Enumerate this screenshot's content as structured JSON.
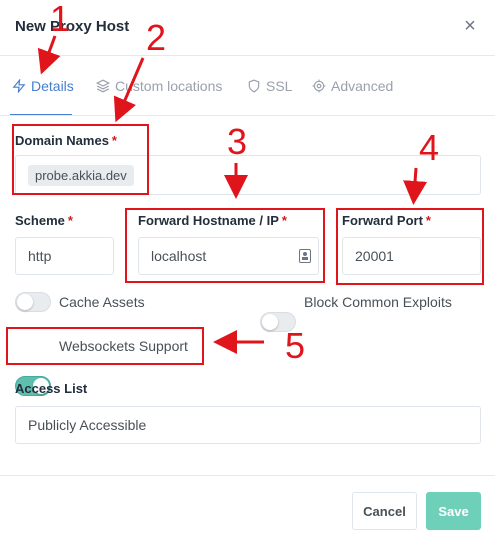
{
  "modal": {
    "title": "New Proxy Host",
    "close_symbol": "×"
  },
  "tabs": [
    {
      "label": "Details",
      "icon": "bolt-icon",
      "active": true
    },
    {
      "label": "Custom locations",
      "icon": "layers-icon",
      "active": false
    },
    {
      "label": "SSL",
      "icon": "shield-icon",
      "active": false
    },
    {
      "label": "Advanced",
      "icon": "gear-icon",
      "active": false
    }
  ],
  "form": {
    "domain_names": {
      "label": "Domain Names",
      "required_mark": "*",
      "tags": [
        "probe.akkia.dev"
      ]
    },
    "scheme": {
      "label": "Scheme",
      "required_mark": "*",
      "value": "http"
    },
    "forward_host": {
      "label": "Forward Hostname / IP",
      "required_mark": "*",
      "value": "localhost"
    },
    "forward_port": {
      "label": "Forward Port",
      "required_mark": "*",
      "value": "20001"
    },
    "toggles": [
      {
        "label": "Cache Assets",
        "checked": false
      },
      {
        "label": "Block Common Exploits",
        "checked": false
      },
      {
        "label": "Websockets Support",
        "checked": true
      }
    ],
    "access_list": {
      "label": "Access List",
      "value": "Publicly Accessible"
    }
  },
  "footer": {
    "cancel_label": "Cancel",
    "save_label": "Save"
  },
  "annotations": [
    "1",
    "2",
    "3",
    "4",
    "5"
  ],
  "colors": {
    "accent": "#467fcf",
    "annotation": "#e0141b",
    "required": "#cd201f",
    "save": "#6fd0ba",
    "toggle_on": "#5fbfae"
  }
}
